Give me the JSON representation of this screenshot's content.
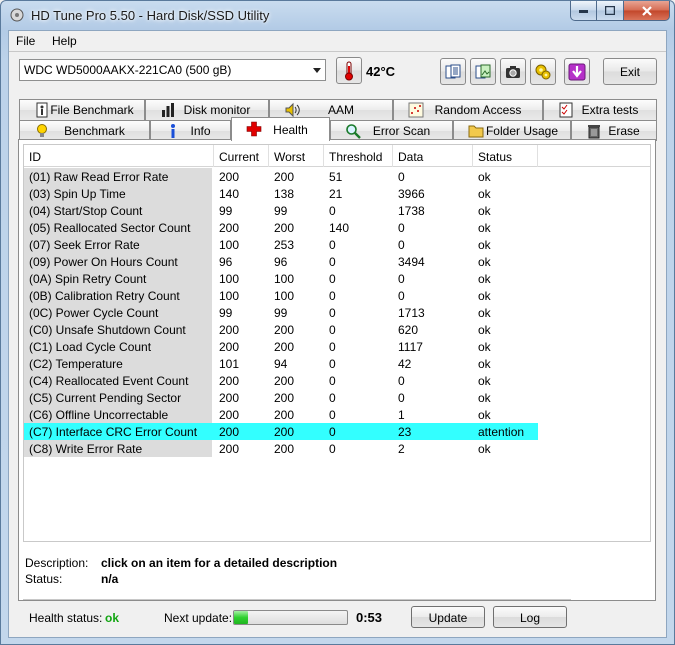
{
  "window": {
    "title": "HD Tune Pro 5.50 - Hard Disk/SSD Utility"
  },
  "menu": {
    "file": "File",
    "help": "Help"
  },
  "toolbar": {
    "drive": "WDC WD5000AAKX-221CA0 (500 gB)",
    "temperature": "42°C",
    "exit_label": "Exit"
  },
  "tabs_top": [
    "File Benchmark",
    "Disk monitor",
    "AAM",
    "Random Access",
    "Extra tests"
  ],
  "tabs_bottom": [
    "Benchmark",
    "Info",
    "Health",
    "Error Scan",
    "Folder Usage",
    "Erase"
  ],
  "active_tab": "Health",
  "table": {
    "columns": [
      "ID",
      "Current",
      "Worst",
      "Threshold",
      "Data",
      "Status"
    ],
    "rows": [
      [
        "(01) Raw Read Error Rate",
        "200",
        "200",
        "51",
        "0",
        "ok"
      ],
      [
        "(03) Spin Up Time",
        "140",
        "138",
        "21",
        "3966",
        "ok"
      ],
      [
        "(04) Start/Stop Count",
        "99",
        "99",
        "0",
        "1738",
        "ok"
      ],
      [
        "(05) Reallocated Sector Count",
        "200",
        "200",
        "140",
        "0",
        "ok"
      ],
      [
        "(07) Seek Error Rate",
        "100",
        "253",
        "0",
        "0",
        "ok"
      ],
      [
        "(09) Power On Hours Count",
        "96",
        "96",
        "0",
        "3494",
        "ok"
      ],
      [
        "(0A) Spin Retry Count",
        "100",
        "100",
        "0",
        "0",
        "ok"
      ],
      [
        "(0B) Calibration Retry Count",
        "100",
        "100",
        "0",
        "0",
        "ok"
      ],
      [
        "(0C) Power Cycle Count",
        "99",
        "99",
        "0",
        "1713",
        "ok"
      ],
      [
        "(C0) Unsafe Shutdown Count",
        "200",
        "200",
        "0",
        "620",
        "ok"
      ],
      [
        "(C1) Load Cycle Count",
        "200",
        "200",
        "0",
        "1117",
        "ok"
      ],
      [
        "(C2) Temperature",
        "101",
        "94",
        "0",
        "42",
        "ok"
      ],
      [
        "(C4) Reallocated Event Count",
        "200",
        "200",
        "0",
        "0",
        "ok"
      ],
      [
        "(C5) Current Pending Sector",
        "200",
        "200",
        "0",
        "0",
        "ok"
      ],
      [
        "(C6) Offline Uncorrectable",
        "200",
        "200",
        "0",
        "1",
        "ok"
      ],
      [
        "(C7) Interface CRC Error Count",
        "200",
        "200",
        "0",
        "23",
        "attention"
      ],
      [
        "(C8) Write Error Rate",
        "200",
        "200",
        "0",
        "2",
        "ok"
      ]
    ],
    "highlight_color": "#33ffff"
  },
  "description": {
    "desc_label": "Description:",
    "desc_value": "click on an item for a detailed description",
    "status_label": "Status:",
    "status_value": "n/a"
  },
  "footer": {
    "health_label": "Health status:",
    "health_value": "ok",
    "health_color": "#11a511",
    "next_label": "Next update:",
    "progress_fraction": 0.12,
    "countdown": "0:53",
    "update_label": "Update",
    "log_label": "Log"
  }
}
